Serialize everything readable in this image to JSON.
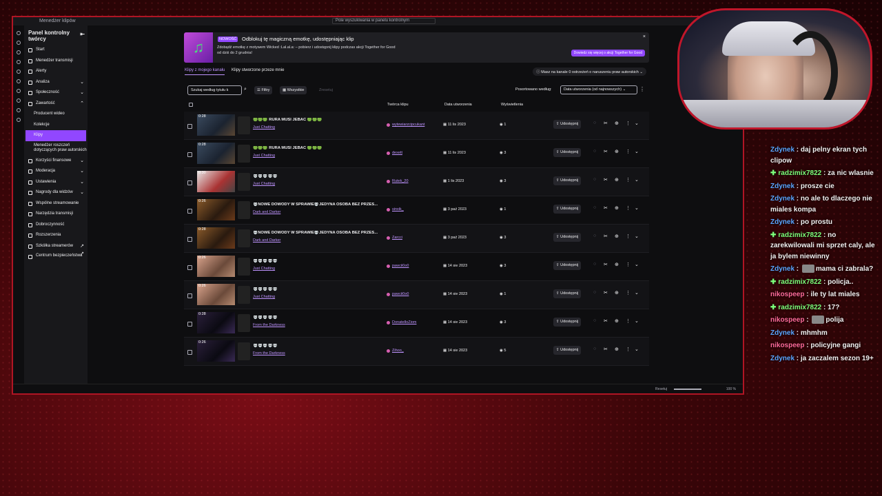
{
  "window": {
    "title": "Menedżer klipów",
    "search_placeholder": "Pole wyszukiwania w panelu kontrolnym"
  },
  "sidebar": {
    "title": "Panel kontrolny twórcy",
    "items": [
      {
        "label": "Start",
        "icon": "home-icon",
        "chevron": ""
      },
      {
        "label": "Menedżer transmisji",
        "icon": "broadcast-icon",
        "chevron": ""
      },
      {
        "label": "Alerty",
        "icon": "bell-icon",
        "chevron": ""
      },
      {
        "label": "Analiza",
        "icon": "chart-icon",
        "chevron": "⌄"
      },
      {
        "label": "Społeczność",
        "icon": "community-icon",
        "chevron": "⌄"
      },
      {
        "label": "Zawartość",
        "icon": "content-icon",
        "chevron": "⌃"
      }
    ],
    "sub_items": [
      "Producent wideo",
      "Kolekcje",
      "Klipy",
      "Menedżer roszczeń dotyczących praw autorskich"
    ],
    "items2": [
      {
        "label": "Korzyści finansowe",
        "icon": "money-icon",
        "chevron": "⌄"
      },
      {
        "label": "Moderacja",
        "icon": "sword-icon",
        "chevron": "⌄"
      },
      {
        "label": "Ustawienia",
        "icon": "settings-icon",
        "chevron": "⌄"
      },
      {
        "label": "Nagrody dla widzów",
        "icon": "reward-icon",
        "chevron": "⌄"
      },
      {
        "label": "Wspólne streamowanie",
        "icon": "collab-icon",
        "chevron": ""
      },
      {
        "label": "Narzędzia transmisji",
        "icon": "tools-icon",
        "chevron": ""
      },
      {
        "label": "Dobroczynność",
        "icon": "heart-icon",
        "chevron": ""
      },
      {
        "label": "Rozszerzenia",
        "icon": "extension-icon",
        "chevron": ""
      },
      {
        "label": "Szkółka streamerów",
        "icon": "school-icon",
        "chevron": "↗"
      },
      {
        "label": "Centrum bezpieczeństwa",
        "icon": "shield-icon",
        "chevron": "↗"
      }
    ]
  },
  "banner": {
    "badge": "NOWOŚĆ",
    "title": "Odblokuj tę magiczną emotkę, udostępniając klip",
    "desc": "Zdobądź emotkę z motywem Wicked :Lal.al.a: – pobierz i udostępnij klipy podczas akcji Together for Good od dziś do 2 grudnia!",
    "cta": "Dowiedz się więcej o akcji Together for Good",
    "emote_icon": "music-note-icon"
  },
  "tabs": [
    "Klipy z mojego kanału",
    "Klipy stworzone przeze mnie"
  ],
  "notice": "Masz na kanale 0 ostrzeżeń o naruszeniu praw autorskich",
  "toolbar": {
    "search_placeholder": "Szukaj według tytułu k",
    "filters": "Filtry",
    "all": "Wszystkie",
    "reset": "Zresetuj",
    "sort_label": "Posortowano według:",
    "sort_value": "Data utworzenia (od najnowszych)"
  },
  "columns": [
    "Twórca klipu",
    "Data utworzenia",
    "Wyświetlenia"
  ],
  "share_label": "Udostępnij",
  "clips": [
    {
      "dur": "0:28",
      "title": "🟢🟢🟢 RURA MUSI JEBAĆ 🟢🟢🟢",
      "cat": "Just Chatting",
      "creator": "wytewiarzcipcukant",
      "date": "11 lis 2023",
      "views": "1",
      "thumb": ""
    },
    {
      "dur": "0:28",
      "title": "🟢🟢🟢 RURA MUSI JEBAĆ 🟢🟢🟢",
      "cat": "Just Chatting",
      "creator": "dexett",
      "date": "11 lis 2023",
      "views": "3",
      "thumb": ""
    },
    {
      "dur": "0:30",
      "title": "💀💀💀💀💀",
      "cat": "Just Chatting",
      "creator": "Rutek_20",
      "date": "1 lis 2023",
      "views": "3",
      "thumb": "light"
    },
    {
      "dur": "0:26",
      "title": "💀NOWE DOWODY W SPRAWIE💀JEDYNA OSOBA BEZ PRZES...",
      "cat": "Dark and Darker",
      "creator": "sinxik_",
      "date": "3 paź 2023",
      "views": "1",
      "thumb": "warm"
    },
    {
      "dur": "0:28",
      "title": "💀NOWE DOWODY W SPRAWIE💀JEDYNA OSOBA BEZ PRZES...",
      "cat": "Dark and Darker",
      "creator": "Zarcci",
      "date": "3 paź 2023",
      "views": "3",
      "thumb": "warm"
    },
    {
      "dur": "0:26",
      "title": "💀💀💀💀💀",
      "cat": "Just Chatting",
      "creator": "pawcii0o0",
      "date": "14 sie 2023",
      "views": "3",
      "thumb": "pink"
    },
    {
      "dur": "0:26",
      "title": "💀💀💀💀💀",
      "cat": "Just Chatting",
      "creator": "pawcii0o0",
      "date": "14 sie 2023",
      "views": "1",
      "thumb": "pink"
    },
    {
      "dur": "0:28",
      "title": "💀💀💀💀💀",
      "cat": "From the Darkness",
      "creator": "DonatelloZiom",
      "date": "14 sie 2023",
      "views": "3",
      "thumb": "dark"
    },
    {
      "dur": "0:26",
      "title": "💀💀💀💀💀",
      "cat": "From the Darkness",
      "creator": "Zihoo_",
      "date": "14 sie 2023",
      "views": "5",
      "thumb": "dark"
    }
  ],
  "statusbar": {
    "reset": "Resetuj",
    "zoom": "100 %"
  },
  "chat": [
    {
      "user": "Zdynek",
      "cls": "u1",
      "text": "daj pelny ekran tych clipow",
      "gem": false,
      "avatar": false
    },
    {
      "user": "radzimix7822",
      "cls": "u2",
      "text": "za nic wlasnie",
      "gem": true,
      "avatar": false
    },
    {
      "user": "Zdynek",
      "cls": "u1",
      "text": "prosze cie",
      "gem": false,
      "avatar": false
    },
    {
      "user": "Zdynek",
      "cls": "u1",
      "text": "no ale to dlaczego nie miales kompa",
      "gem": false,
      "avatar": false
    },
    {
      "user": "Zdynek",
      "cls": "u1",
      "text": "po prostu",
      "gem": false,
      "avatar": false
    },
    {
      "user": "radzimix7822",
      "cls": "u2",
      "text": "no zarekwilowali mi sprzet caly, ale ja bylem niewinny",
      "gem": true,
      "avatar": false
    },
    {
      "user": "Zdynek",
      "cls": "u1",
      "text": "mama ci zabrala?",
      "gem": false,
      "avatar": true
    },
    {
      "user": "radzimix7822",
      "cls": "u2",
      "text": "policja..",
      "gem": true,
      "avatar": false
    },
    {
      "user": "nikospeep",
      "cls": "u3",
      "text": "ile ty lat miales",
      "gem": false,
      "avatar": false
    },
    {
      "user": "radzimix7822",
      "cls": "u2",
      "text": "17?",
      "gem": true,
      "avatar": false
    },
    {
      "user": "nikospeep",
      "cls": "u3",
      "text": "polija",
      "gem": false,
      "avatar": true
    },
    {
      "user": "Zdynek",
      "cls": "u1",
      "text": "mhmhm",
      "gem": false,
      "avatar": false
    },
    {
      "user": "nikospeep",
      "cls": "u3",
      "text": "policyjne gangi",
      "gem": false,
      "avatar": false
    },
    {
      "user": "Zdynek",
      "cls": "u1",
      "text": "ja zaczalem sezon 19+",
      "gem": false,
      "avatar": false
    }
  ]
}
